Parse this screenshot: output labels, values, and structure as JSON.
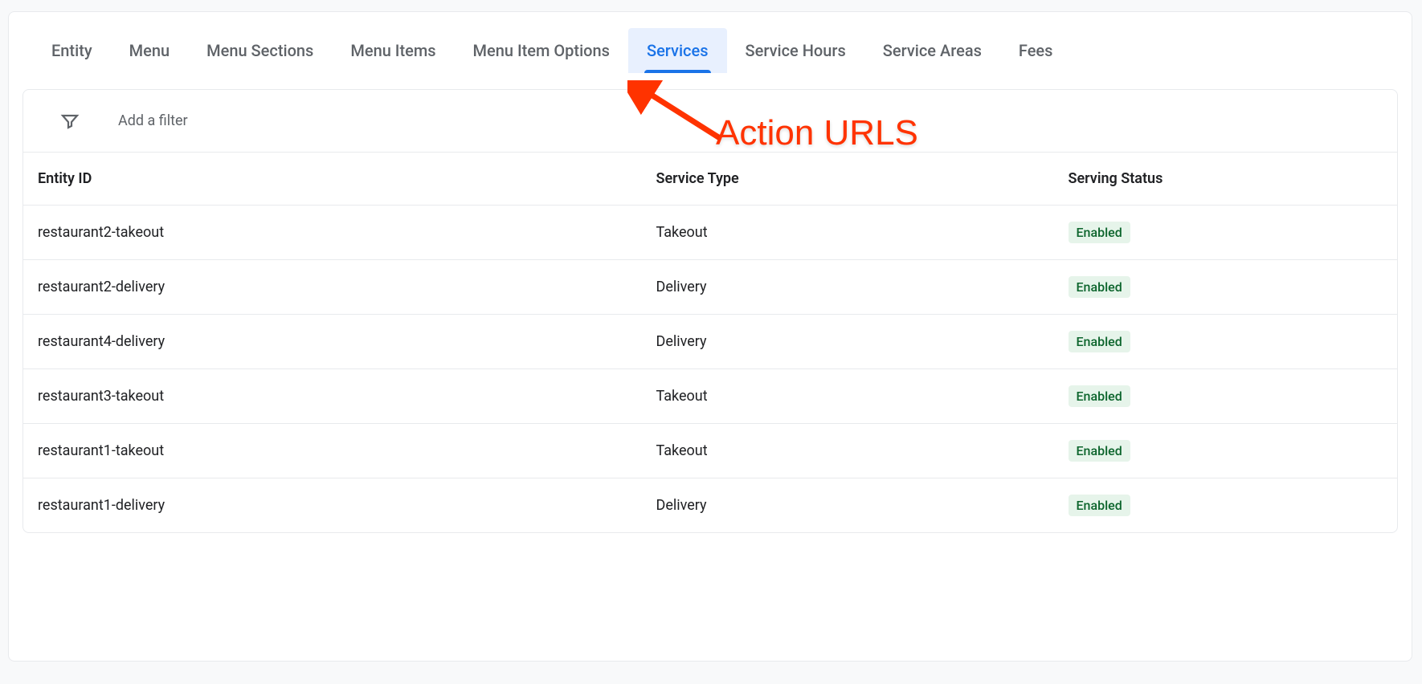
{
  "tabs": [
    {
      "label": "Entity"
    },
    {
      "label": "Menu"
    },
    {
      "label": "Menu Sections"
    },
    {
      "label": "Menu Items"
    },
    {
      "label": "Menu Item Options"
    },
    {
      "label": "Services"
    },
    {
      "label": "Service Hours"
    },
    {
      "label": "Service Areas"
    },
    {
      "label": "Fees"
    }
  ],
  "active_tab_index": 5,
  "filter": {
    "placeholder": "Add a filter"
  },
  "columns": [
    "Entity ID",
    "Service Type",
    "Serving Status"
  ],
  "rows": [
    {
      "entity_id": "restaurant2-takeout",
      "service_type": "Takeout",
      "status": "Enabled"
    },
    {
      "entity_id": "restaurant2-delivery",
      "service_type": "Delivery",
      "status": "Enabled"
    },
    {
      "entity_id": "restaurant4-delivery",
      "service_type": "Delivery",
      "status": "Enabled"
    },
    {
      "entity_id": "restaurant3-takeout",
      "service_type": "Takeout",
      "status": "Enabled"
    },
    {
      "entity_id": "restaurant1-takeout",
      "service_type": "Takeout",
      "status": "Enabled"
    },
    {
      "entity_id": "restaurant1-delivery",
      "service_type": "Delivery",
      "status": "Enabled"
    }
  ],
  "annotation": {
    "text": "Action URLS"
  }
}
